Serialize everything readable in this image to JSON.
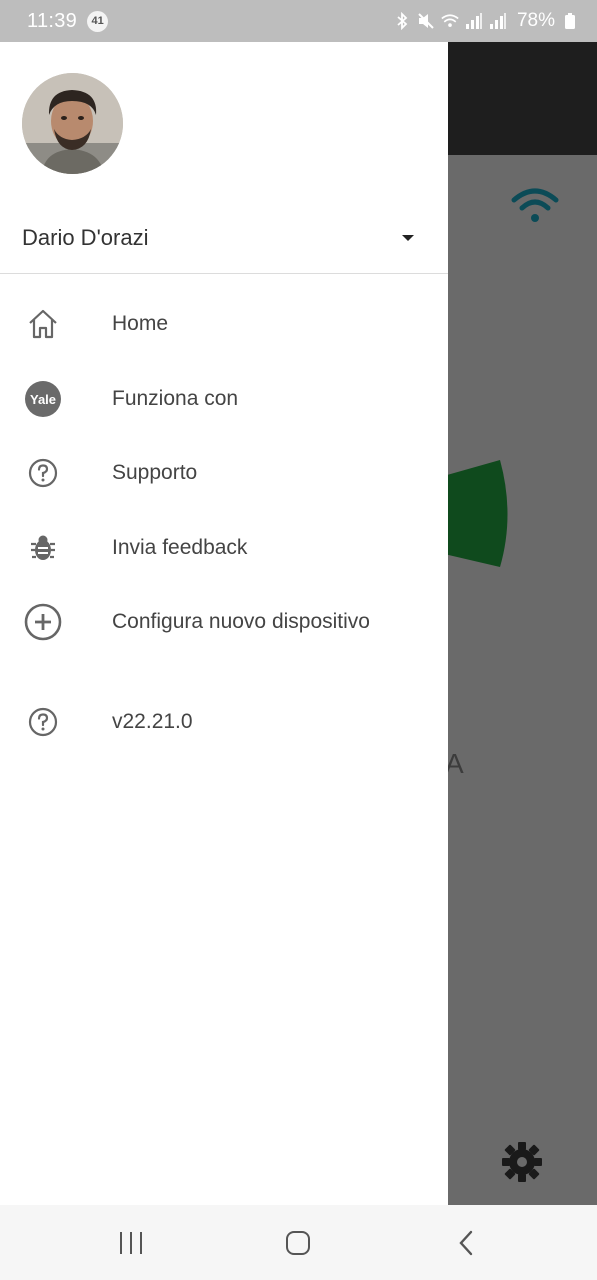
{
  "status_bar": {
    "time": "11:39",
    "notification_count": "41",
    "battery": "78%",
    "icons": [
      "bluetooth-icon",
      "mute-icon",
      "wifi-icon",
      "signal-icon",
      "signal-icon",
      "battery-icon"
    ]
  },
  "background_app": {
    "partial_letter": "A"
  },
  "drawer": {
    "user": {
      "name": "Dario D'orazi"
    },
    "menu": [
      {
        "label": "Home",
        "icon": "home-icon"
      },
      {
        "label": "Funziona con",
        "icon": "yale-logo-icon",
        "icon_text": "Yale"
      },
      {
        "label": "Supporto",
        "icon": "help-circle-icon"
      },
      {
        "label": "Invia feedback",
        "icon": "bug-icon"
      },
      {
        "label": "Configura nuovo dispositivo",
        "icon": "add-circle-icon"
      },
      {
        "label": "v22.21.0",
        "icon": "help-circle-icon"
      }
    ]
  },
  "nav_bar": {
    "buttons": [
      "recent-apps-icon",
      "home-button-icon",
      "back-icon"
    ]
  },
  "colors": {
    "status_bar": "#bdbdbd",
    "scrim": "#6a6a6a",
    "green_dial": "#0f4a1d",
    "wifi_teal": "#0b4b57"
  }
}
